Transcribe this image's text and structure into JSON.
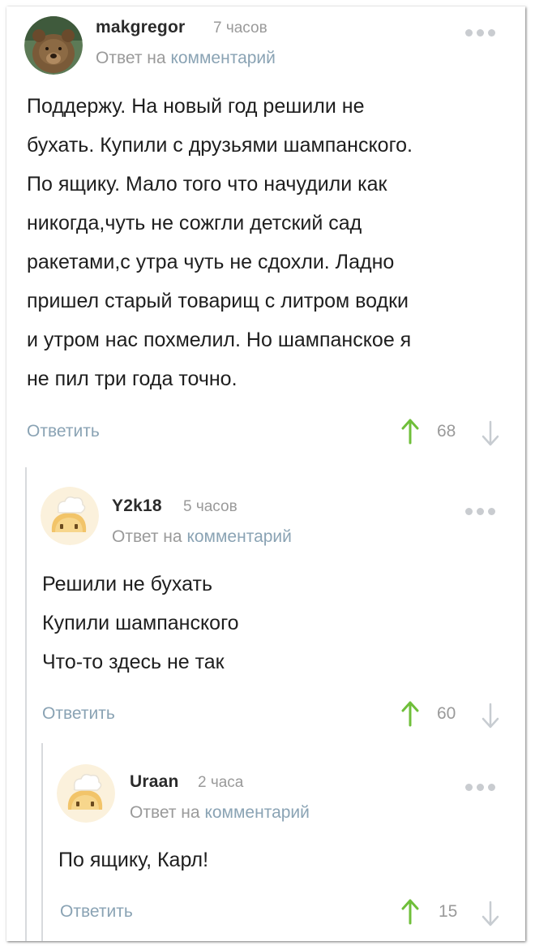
{
  "comments": [
    {
      "username": "makgregor",
      "time": "7 часов",
      "reply_prefix": "Ответ на",
      "reply_link": "комментарий",
      "lines": [
        "Поддержу. На новый год решили не",
        "бухать. Купили с друзьями шампанского.",
        "По ящику. Мало того что начудили как",
        "никогда,чуть не сожгли детский сад",
        "ракетами,с утра чуть не сдохли. Ладно",
        "пришел старый товарищ с литром водки",
        "и утром нас похмелил. Но шампанское я",
        "не пил три года точно."
      ],
      "reply_label": "Ответить",
      "rating": "68",
      "avatar_icon": "bear-avatar"
    },
    {
      "username": "Y2k18",
      "time": "5 часов",
      "reply_prefix": "Ответ на",
      "reply_link": "комментарий",
      "lines": [
        "Решили не бухать",
        "Купили шампанского",
        "Что-то здесь не так"
      ],
      "reply_label": "Ответить",
      "rating": "60",
      "avatar_icon": "chef-bread-avatar"
    },
    {
      "username": "Uraan",
      "time": "2 часа",
      "reply_prefix": "Ответ на",
      "reply_link": "комментарий",
      "lines": [
        "По ящику, Карл!"
      ],
      "reply_label": "Ответить",
      "rating": "15",
      "avatar_icon": "chef-bread-avatar"
    }
  ],
  "colors": {
    "accent_link": "#8aa3b4",
    "upvote": "#6fbf3a",
    "muted": "#9a9a9a"
  }
}
